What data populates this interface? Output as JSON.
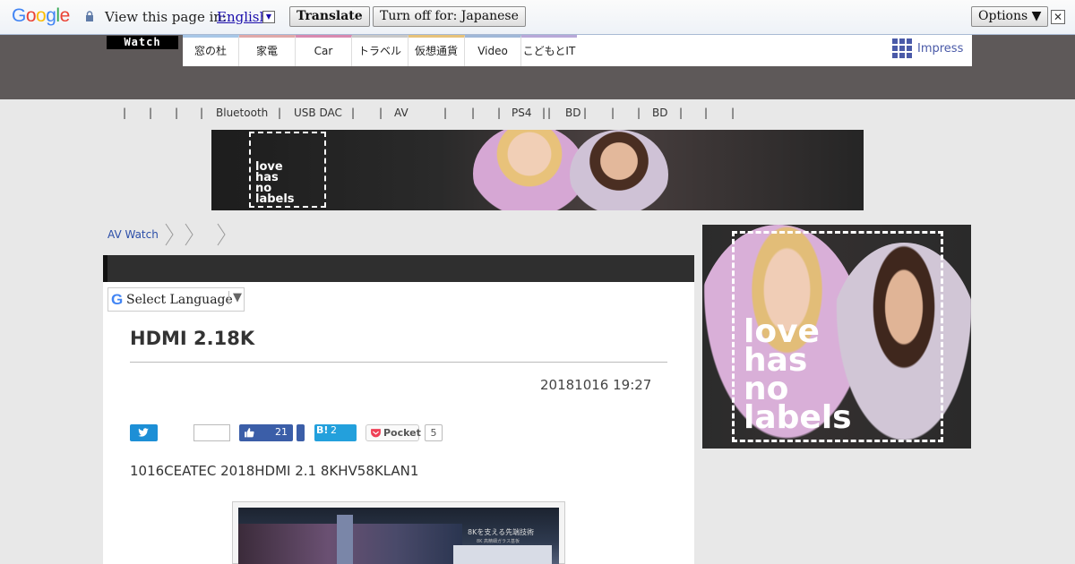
{
  "translate_bar": {
    "logo_letters": [
      {
        "char": "G",
        "color": "#4285f4"
      },
      {
        "char": "o",
        "color": "#ea4335"
      },
      {
        "char": "o",
        "color": "#fbbc05"
      },
      {
        "char": "g",
        "color": "#4285f4"
      },
      {
        "char": "l",
        "color": "#34a853"
      },
      {
        "char": "e",
        "color": "#ea4335"
      }
    ],
    "prompt": "View this page in:",
    "language": "English",
    "translate_label": "Translate",
    "turn_off_label": "Turn off for: Japanese",
    "options_label": "Options ▼",
    "close_glyph": "✕"
  },
  "header": {
    "logo": "Watch",
    "tabs": [
      {
        "label": "窓の杜",
        "color": "#a7c7e7"
      },
      {
        "label": "家電",
        "color": "#e0a8a8"
      },
      {
        "label": "Car",
        "color": "#d88ab0"
      },
      {
        "label": "トラベル",
        "color": "#c8c8c8"
      },
      {
        "label": "仮想通貨",
        "color": "#e6c27a"
      },
      {
        "label": "Video",
        "color": "#a0b8d8"
      },
      {
        "label": "こどもとIT",
        "color": "#b8a8d8"
      }
    ],
    "brand": "Impress",
    "brand_color": "#4a5aa8"
  },
  "subnav": {
    "items": [
      "|",
      "|",
      "|",
      "|",
      "Bluetooth",
      "|",
      "USB DAC",
      "|",
      "|",
      "AV",
      "|",
      "|",
      "|",
      "|",
      "PS4",
      "|",
      "BD",
      "|",
      "|",
      "|",
      "BD",
      "|",
      "|",
      "|"
    ]
  },
  "ad": {
    "line1": "love",
    "line2": "has",
    "line3": "no",
    "line4": "labels"
  },
  "breadcrumb": {
    "home": "AV Watch"
  },
  "translate_widget": {
    "g_letter": "G",
    "label": "Select Language",
    "arrow": "▼"
  },
  "article": {
    "title": "HDMI 2.18K",
    "date": "20181016 19:27",
    "lede": "1016CEATEC 2018HDMI 2.1 8KHV58KLAN1",
    "photo_caption": "8Kを支える先端技術",
    "photo_subcaption": "8K 高精細ガラス基板"
  },
  "share": {
    "facebook_count": "21",
    "hatena_label": "B!",
    "hatena_count": "2",
    "pocket_label": "Pocket",
    "pocket_count": "5"
  }
}
